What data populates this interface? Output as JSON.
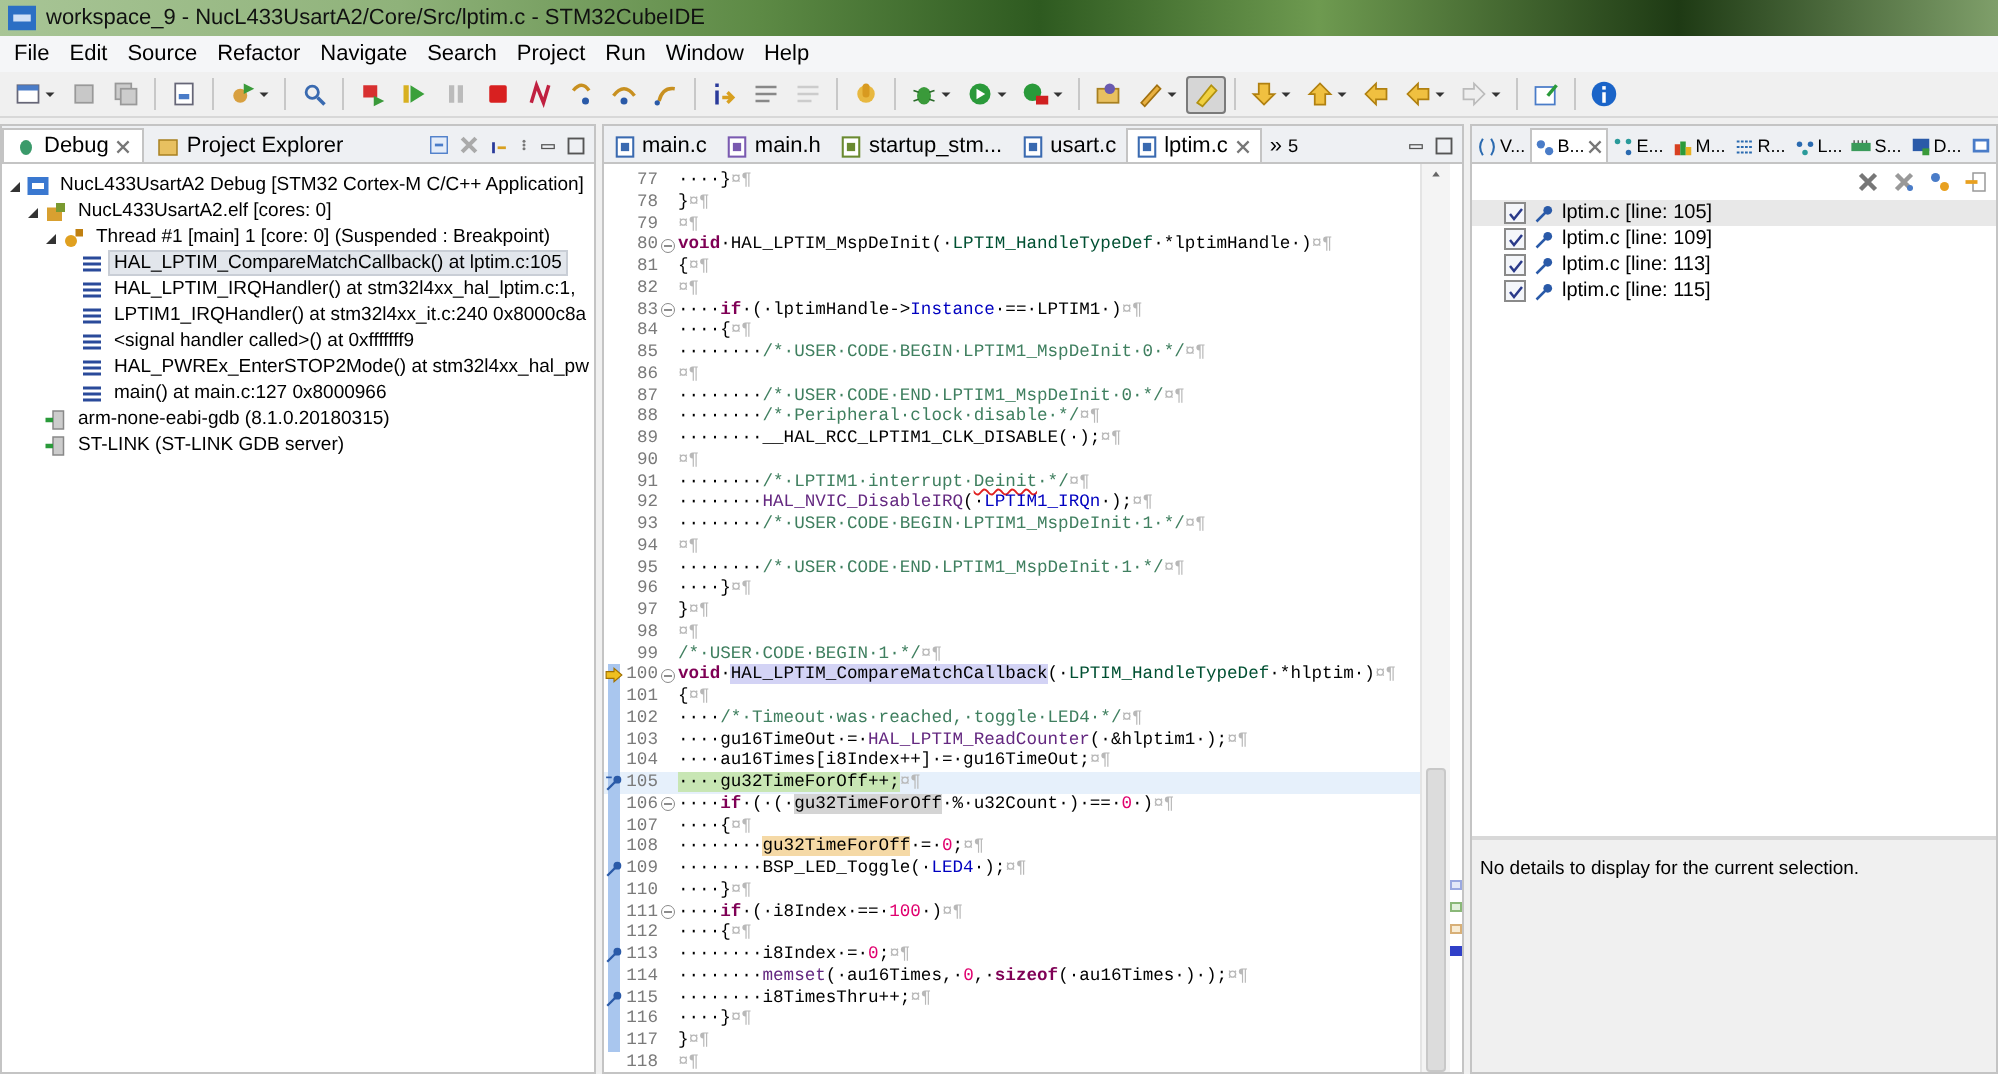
{
  "window": {
    "title": "workspace_9 - NucL433UsartA2/Core/Src/lptim.c - STM32CubeIDE"
  },
  "menu": [
    "File",
    "Edit",
    "Source",
    "Refactor",
    "Navigate",
    "Search",
    "Project",
    "Run",
    "Window",
    "Help"
  ],
  "toolbar": {
    "highlight_toggle": {
      "pressed": true
    }
  },
  "debug_view": {
    "tabs": [
      {
        "label": "Debug",
        "selected": true
      },
      {
        "label": "Project Explorer",
        "selected": false
      }
    ],
    "tree": [
      {
        "kind": "launch",
        "label": "NucL433UsartA2 Debug [STM32 Cortex-M C/C++ Application]",
        "selected": false,
        "expanded": true,
        "children": [
          {
            "kind": "process",
            "label": "NucL433UsartA2.elf [cores: 0]",
            "selected": false,
            "expanded": true,
            "children": [
              {
                "kind": "thread",
                "label": "Thread #1 [main] 1 [core: 0] (Suspended : Breakpoint)",
                "selected": false,
                "expanded": true,
                "children": [
                  {
                    "kind": "frame",
                    "label": "HAL_LPTIM_CompareMatchCallback() at lptim.c:105",
                    "selected": true
                  },
                  {
                    "kind": "frame",
                    "label": "HAL_LPTIM_IRQHandler() at stm32l4xx_hal_lptim.c:1,",
                    "selected": false
                  },
                  {
                    "kind": "frame",
                    "label": "LPTIM1_IRQHandler() at stm32l4xx_it.c:240 0x8000c8a",
                    "selected": false
                  },
                  {
                    "kind": "frame",
                    "label": "<signal handler called>() at 0xfffffff9",
                    "selected": false
                  },
                  {
                    "kind": "frame",
                    "label": "HAL_PWREx_EnterSTOP2Mode() at stm32l4xx_hal_pw",
                    "selected": false
                  },
                  {
                    "kind": "frame",
                    "label": "main() at main.c:127 0x8000966",
                    "selected": false
                  }
                ]
              }
            ]
          },
          {
            "kind": "gdb",
            "label": "arm-none-eabi-gdb (8.1.0.20180315)",
            "selected": false
          },
          {
            "kind": "gdb",
            "label": "ST-LINK (ST-LINK GDB server)",
            "selected": false
          }
        ]
      }
    ]
  },
  "editor": {
    "tabs": [
      {
        "label": "main.c",
        "kind": "c",
        "selected": false
      },
      {
        "label": "main.h",
        "kind": "h",
        "selected": false
      },
      {
        "label": "startup_stm...",
        "kind": "asm",
        "selected": false
      },
      {
        "label": "usart.c",
        "kind": "c",
        "selected": false
      },
      {
        "label": "lptim.c",
        "kind": "c",
        "selected": true
      }
    ],
    "overflow": {
      "mark": "»",
      "count": "5"
    },
    "lines": [
      {
        "number": "77",
        "scope": false,
        "pointer": false,
        "fold": false,
        "breakpoint": false,
        "current": false,
        "segments": [
          {
            "kind": "plain",
            "text": "····}"
          },
          {
            "kind": "mark",
            "text": "¤¶"
          }
        ]
      },
      {
        "number": "78",
        "scope": false,
        "pointer": false,
        "fold": false,
        "breakpoint": false,
        "current": false,
        "segments": [
          {
            "kind": "plain",
            "text": "}"
          },
          {
            "kind": "mark",
            "text": "¤¶"
          }
        ]
      },
      {
        "number": "79",
        "scope": false,
        "pointer": false,
        "fold": false,
        "breakpoint": false,
        "current": false,
        "segments": [
          {
            "kind": "mark",
            "text": "¤¶"
          }
        ]
      },
      {
        "number": "80",
        "scope": false,
        "pointer": false,
        "fold": true,
        "breakpoint": false,
        "current": false,
        "segments": [
          {
            "kind": "keyword",
            "text": "void"
          },
          {
            "kind": "plain",
            "text": "·HAL_LPTIM_MspDeInit(·"
          },
          {
            "kind": "type",
            "text": "LPTIM_HandleTypeDef"
          },
          {
            "kind": "plain",
            "text": "·*lptimHandle·)"
          },
          {
            "kind": "mark",
            "text": "¤¶"
          }
        ]
      },
      {
        "number": "81",
        "scope": false,
        "pointer": false,
        "fold": false,
        "breakpoint": false,
        "current": false,
        "segments": [
          {
            "kind": "plain",
            "text": "{"
          },
          {
            "kind": "mark",
            "text": "¤¶"
          }
        ]
      },
      {
        "number": "82",
        "scope": false,
        "pointer": false,
        "fold": false,
        "breakpoint": false,
        "current": false,
        "segments": [
          {
            "kind": "mark",
            "text": "¤¶"
          }
        ]
      },
      {
        "number": "83",
        "scope": false,
        "pointer": false,
        "fold": true,
        "breakpoint": false,
        "current": false,
        "segments": [
          {
            "kind": "plain",
            "text": "····"
          },
          {
            "kind": "keyword",
            "text": "if"
          },
          {
            "kind": "plain",
            "text": "·(·lptimHandle->"
          },
          {
            "kind": "field",
            "text": "Instance"
          },
          {
            "kind": "plain",
            "text": "·==·LPTIM1·)"
          },
          {
            "kind": "mark",
            "text": "¤¶"
          }
        ]
      },
      {
        "number": "84",
        "scope": false,
        "pointer": false,
        "fold": false,
        "breakpoint": false,
        "current": false,
        "segments": [
          {
            "kind": "plain",
            "text": "····{"
          },
          {
            "kind": "mark",
            "text": "¤¶"
          }
        ]
      },
      {
        "number": "85",
        "scope": false,
        "pointer": false,
        "fold": false,
        "breakpoint": false,
        "current": false,
        "segments": [
          {
            "kind": "plain",
            "text": "········"
          },
          {
            "kind": "comment",
            "text": "/*·USER·CODE·BEGIN·LPTIM1_MspDeInit·0·*/"
          },
          {
            "kind": "mark",
            "text": "¤¶"
          }
        ]
      },
      {
        "number": "86",
        "scope": false,
        "pointer": false,
        "fold": false,
        "breakpoint": false,
        "current": false,
        "segments": [
          {
            "kind": "mark",
            "text": "¤¶"
          }
        ]
      },
      {
        "number": "87",
        "scope": false,
        "pointer": false,
        "fold": false,
        "breakpoint": false,
        "current": false,
        "segments": [
          {
            "kind": "plain",
            "text": "········"
          },
          {
            "kind": "comment",
            "text": "/*·USER·CODE·END·LPTIM1_MspDeInit·0·*/"
          },
          {
            "kind": "mark",
            "text": "¤¶"
          }
        ]
      },
      {
        "number": "88",
        "scope": false,
        "pointer": false,
        "fold": false,
        "breakpoint": false,
        "current": false,
        "segments": [
          {
            "kind": "plain",
            "text": "········"
          },
          {
            "kind": "comment",
            "text": "/*·Peripheral·clock·disable·*/"
          },
          {
            "kind": "mark",
            "text": "¤¶"
          }
        ]
      },
      {
        "number": "89",
        "scope": false,
        "pointer": false,
        "fold": false,
        "breakpoint": false,
        "current": false,
        "segments": [
          {
            "kind": "plain",
            "text": "········__HAL_RCC_LPTIM1_CLK_DISABLE(·);"
          },
          {
            "kind": "mark",
            "text": "¤¶"
          }
        ]
      },
      {
        "number": "90",
        "scope": false,
        "pointer": false,
        "fold": false,
        "breakpoint": false,
        "current": false,
        "segments": [
          {
            "kind": "mark",
            "text": "¤¶"
          }
        ]
      },
      {
        "number": "91",
        "scope": false,
        "pointer": false,
        "fold": false,
        "breakpoint": false,
        "current": false,
        "segments": [
          {
            "kind": "plain",
            "text": "········"
          },
          {
            "kind": "comment",
            "text": "/*·LPTIM1·interrupt·"
          },
          {
            "kind": "misspelled",
            "text": "Deinit"
          },
          {
            "kind": "comment",
            "text": "·*/"
          },
          {
            "kind": "mark",
            "text": "¤¶"
          }
        ]
      },
      {
        "number": "92",
        "scope": false,
        "pointer": false,
        "fold": false,
        "breakpoint": false,
        "current": false,
        "segments": [
          {
            "kind": "plain",
            "text": "········"
          },
          {
            "kind": "call",
            "text": "HAL_NVIC_DisableIRQ"
          },
          {
            "kind": "plain",
            "text": "(·"
          },
          {
            "kind": "field",
            "text": "LPTIM1_IRQn"
          },
          {
            "kind": "plain",
            "text": "·);"
          },
          {
            "kind": "mark",
            "text": "¤¶"
          }
        ]
      },
      {
        "number": "93",
        "scope": false,
        "pointer": false,
        "fold": false,
        "breakpoint": false,
        "current": false,
        "segments": [
          {
            "kind": "plain",
            "text": "········"
          },
          {
            "kind": "comment",
            "text": "/*·USER·CODE·BEGIN·LPTIM1_MspDeInit·1·*/"
          },
          {
            "kind": "mark",
            "text": "¤¶"
          }
        ]
      },
      {
        "number": "94",
        "scope": false,
        "pointer": false,
        "fold": false,
        "breakpoint": false,
        "current": false,
        "segments": [
          {
            "kind": "mark",
            "text": "¤¶"
          }
        ]
      },
      {
        "number": "95",
        "scope": false,
        "pointer": false,
        "fold": false,
        "breakpoint": false,
        "current": false,
        "segments": [
          {
            "kind": "plain",
            "text": "········"
          },
          {
            "kind": "comment",
            "text": "/*·USER·CODE·END·LPTIM1_MspDeInit·1·*/"
          },
          {
            "kind": "mark",
            "text": "¤¶"
          }
        ]
      },
      {
        "number": "96",
        "scope": false,
        "pointer": false,
        "fold": false,
        "breakpoint": false,
        "current": false,
        "segments": [
          {
            "kind": "plain",
            "text": "····}"
          },
          {
            "kind": "mark",
            "text": "¤¶"
          }
        ]
      },
      {
        "number": "97",
        "scope": false,
        "pointer": false,
        "fold": false,
        "breakpoint": false,
        "current": false,
        "segments": [
          {
            "kind": "plain",
            "text": "}"
          },
          {
            "kind": "mark",
            "text": "¤¶"
          }
        ]
      },
      {
        "number": "98",
        "scope": false,
        "pointer": false,
        "fold": false,
        "breakpoint": false,
        "current": false,
        "segments": [
          {
            "kind": "mark",
            "text": "¤¶"
          }
        ]
      },
      {
        "number": "99",
        "scope": false,
        "pointer": false,
        "fold": false,
        "breakpoint": false,
        "current": false,
        "segments": [
          {
            "kind": "comment",
            "text": "/*·USER·CODE·BEGIN·1·*/"
          },
          {
            "kind": "mark",
            "text": "¤¶"
          }
        ]
      },
      {
        "number": "100",
        "scope": true,
        "pointer": true,
        "fold": true,
        "breakpoint": false,
        "current": false,
        "segments": [
          {
            "kind": "keyword",
            "text": "void"
          },
          {
            "kind": "plain",
            "text": "·"
          },
          {
            "kind": "selection",
            "text": "HAL_LPTIM_CompareMatchCallback"
          },
          {
            "kind": "plain",
            "text": "(·"
          },
          {
            "kind": "type",
            "text": "LPTIM_HandleTypeDef"
          },
          {
            "kind": "plain",
            "text": "·*hlptim·)"
          },
          {
            "kind": "mark",
            "text": "¤¶"
          }
        ]
      },
      {
        "number": "101",
        "scope": true,
        "pointer": false,
        "fold": false,
        "breakpoint": false,
        "current": false,
        "segments": [
          {
            "kind": "plain",
            "text": "{"
          },
          {
            "kind": "mark",
            "text": "¤¶"
          }
        ]
      },
      {
        "number": "102",
        "scope": true,
        "pointer": false,
        "fold": false,
        "breakpoint": false,
        "current": false,
        "segments": [
          {
            "kind": "plain",
            "text": "····"
          },
          {
            "kind": "comment",
            "text": "/*·Timeout·was·reached,·toggle·LED4·*/"
          },
          {
            "kind": "mark",
            "text": "¤¶"
          }
        ]
      },
      {
        "number": "103",
        "scope": true,
        "pointer": false,
        "fold": false,
        "breakpoint": false,
        "current": false,
        "segments": [
          {
            "kind": "plain",
            "text": "····gu16TimeOut·=·"
          },
          {
            "kind": "call",
            "text": "HAL_LPTIM_ReadCounter"
          },
          {
            "kind": "plain",
            "text": "(·&hlptim1·);"
          },
          {
            "kind": "mark",
            "text": "¤¶"
          }
        ]
      },
      {
        "number": "104",
        "scope": true,
        "pointer": false,
        "fold": false,
        "breakpoint": false,
        "current": false,
        "segments": [
          {
            "kind": "plain",
            "text": "····au16Times[i8Index++]·=·gu16TimeOut;"
          },
          {
            "kind": "mark",
            "text": "¤¶"
          }
        ]
      },
      {
        "number": "105",
        "scope": true,
        "pointer": false,
        "fold": false,
        "breakpoint": true,
        "current": true,
        "segments": [
          {
            "kind": "plain",
            "text": "····gu32TimeForOff++;"
          },
          {
            "kind": "mark",
            "text": "¤¶"
          }
        ]
      },
      {
        "number": "106",
        "scope": true,
        "pointer": false,
        "fold": true,
        "breakpoint": false,
        "current": false,
        "segments": [
          {
            "kind": "plain",
            "text": "····"
          },
          {
            "kind": "keyword",
            "text": "if"
          },
          {
            "kind": "plain",
            "text": "·(·(·"
          },
          {
            "kind": "occurrence",
            "text": "gu32TimeForOff"
          },
          {
            "kind": "plain",
            "text": "·%·u32Count·)·==·"
          },
          {
            "kind": "number",
            "text": "0"
          },
          {
            "kind": "plain",
            "text": "·)"
          },
          {
            "kind": "mark",
            "text": "¤¶"
          }
        ]
      },
      {
        "number": "107",
        "scope": true,
        "pointer": false,
        "fold": false,
        "breakpoint": false,
        "current": false,
        "segments": [
          {
            "kind": "plain",
            "text": "····{"
          },
          {
            "kind": "mark",
            "text": "¤¶"
          }
        ]
      },
      {
        "number": "108",
        "scope": true,
        "pointer": false,
        "fold": false,
        "breakpoint": false,
        "current": false,
        "segments": [
          {
            "kind": "plain",
            "text": "········"
          },
          {
            "kind": "write_occurrence",
            "text": "gu32TimeForOff"
          },
          {
            "kind": "plain",
            "text": "·=·"
          },
          {
            "kind": "number",
            "text": "0"
          },
          {
            "kind": "plain",
            "text": ";"
          },
          {
            "kind": "mark",
            "text": "¤¶"
          }
        ]
      },
      {
        "number": "109",
        "scope": true,
        "pointer": false,
        "fold": false,
        "breakpoint": true,
        "current": false,
        "segments": [
          {
            "kind": "plain",
            "text": "········BSP_LED_Toggle(·"
          },
          {
            "kind": "field",
            "text": "LED4"
          },
          {
            "kind": "plain",
            "text": "·);"
          },
          {
            "kind": "mark",
            "text": "¤¶"
          }
        ]
      },
      {
        "number": "110",
        "scope": true,
        "pointer": false,
        "fold": false,
        "breakpoint": false,
        "current": false,
        "segments": [
          {
            "kind": "plain",
            "text": "····}"
          },
          {
            "kind": "mark",
            "text": "¤¶"
          }
        ]
      },
      {
        "number": "111",
        "scope": true,
        "pointer": false,
        "fold": true,
        "breakpoint": false,
        "current": false,
        "segments": [
          {
            "kind": "plain",
            "text": "····"
          },
          {
            "kind": "keyword",
            "text": "if"
          },
          {
            "kind": "plain",
            "text": "·(·i8Index·==·"
          },
          {
            "kind": "number",
            "text": "100"
          },
          {
            "kind": "plain",
            "text": "·)"
          },
          {
            "kind": "mark",
            "text": "¤¶"
          }
        ]
      },
      {
        "number": "112",
        "scope": true,
        "pointer": false,
        "fold": false,
        "breakpoint": false,
        "current": false,
        "segments": [
          {
            "kind": "plain",
            "text": "····{"
          },
          {
            "kind": "mark",
            "text": "¤¶"
          }
        ]
      },
      {
        "number": "113",
        "scope": true,
        "pointer": false,
        "fold": false,
        "breakpoint": true,
        "current": false,
        "segments": [
          {
            "kind": "plain",
            "text": "········i8Index·=·"
          },
          {
            "kind": "number",
            "text": "0"
          },
          {
            "kind": "plain",
            "text": ";"
          },
          {
            "kind": "mark",
            "text": "¤¶"
          }
        ]
      },
      {
        "number": "114",
        "scope": true,
        "pointer": false,
        "fold": false,
        "breakpoint": false,
        "current": false,
        "segments": [
          {
            "kind": "plain",
            "text": "········"
          },
          {
            "kind": "call",
            "text": "memset"
          },
          {
            "kind": "plain",
            "text": "(·au16Times,·"
          },
          {
            "kind": "number",
            "text": "0"
          },
          {
            "kind": "plain",
            "text": ",·"
          },
          {
            "kind": "keyword",
            "text": "sizeof"
          },
          {
            "kind": "plain",
            "text": "(·au16Times·)·);"
          },
          {
            "kind": "mark",
            "text": "¤¶"
          }
        ]
      },
      {
        "number": "115",
        "scope": true,
        "pointer": false,
        "fold": false,
        "breakpoint": true,
        "current": false,
        "segments": [
          {
            "kind": "plain",
            "text": "········i8TimesThru++;"
          },
          {
            "kind": "mark",
            "text": "¤¶"
          }
        ]
      },
      {
        "number": "116",
        "scope": true,
        "pointer": false,
        "fold": false,
        "breakpoint": false,
        "current": false,
        "segments": [
          {
            "kind": "plain",
            "text": "····}"
          },
          {
            "kind": "mark",
            "text": "¤¶"
          }
        ]
      },
      {
        "number": "117",
        "scope": true,
        "pointer": false,
        "fold": false,
        "breakpoint": false,
        "current": false,
        "segments": [
          {
            "kind": "plain",
            "text": "}"
          },
          {
            "kind": "mark",
            "text": "¤¶"
          }
        ]
      },
      {
        "number": "118",
        "scope": false,
        "pointer": false,
        "fold": false,
        "breakpoint": false,
        "current": false,
        "segments": [
          {
            "kind": "mark",
            "text": "¤¶"
          }
        ]
      }
    ]
  },
  "breakpoints_view": {
    "tabs": [
      {
        "kind": "variables",
        "label": "V...",
        "selected": false
      },
      {
        "kind": "breakpoints",
        "label": "B...",
        "selected": true
      },
      {
        "kind": "expressions",
        "label": "E...",
        "selected": false
      },
      {
        "kind": "modules",
        "label": "M...",
        "selected": false
      },
      {
        "kind": "registers",
        "label": "R...",
        "selected": false
      },
      {
        "kind": "live",
        "label": "L...",
        "selected": false
      },
      {
        "kind": "sfr",
        "label": "S...",
        "selected": false
      },
      {
        "kind": "disassembly",
        "label": "D...",
        "selected": false
      },
      {
        "kind": "console",
        "selected": false
      }
    ],
    "items": [
      {
        "label": "lptim.c [line: 105]",
        "checked": true,
        "selected": true
      },
      {
        "label": "lptim.c [line: 109]",
        "checked": true,
        "selected": false
      },
      {
        "label": "lptim.c [line: 113]",
        "checked": true,
        "selected": false
      },
      {
        "label": "lptim.c [line: 115]",
        "checked": true,
        "selected": false
      }
    ],
    "details": "No details to display for the current selection."
  }
}
